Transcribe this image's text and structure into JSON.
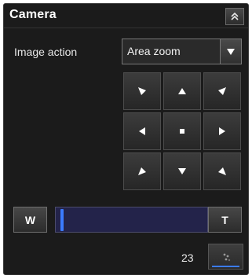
{
  "panel": {
    "title": "Camera"
  },
  "image_action": {
    "label": "Image action",
    "selected": "Area zoom"
  },
  "zoom": {
    "wide_label": "W",
    "tele_label": "T",
    "position_fraction": 0.02,
    "value": "23"
  },
  "colors": {
    "background": "#1b1b1b",
    "accent": "#3b7bff",
    "track": "#23234a"
  },
  "icons": {
    "collapse": "double-chevron-up-icon",
    "dropdown": "triangle-down-icon",
    "preset": "preset-position-icon"
  }
}
